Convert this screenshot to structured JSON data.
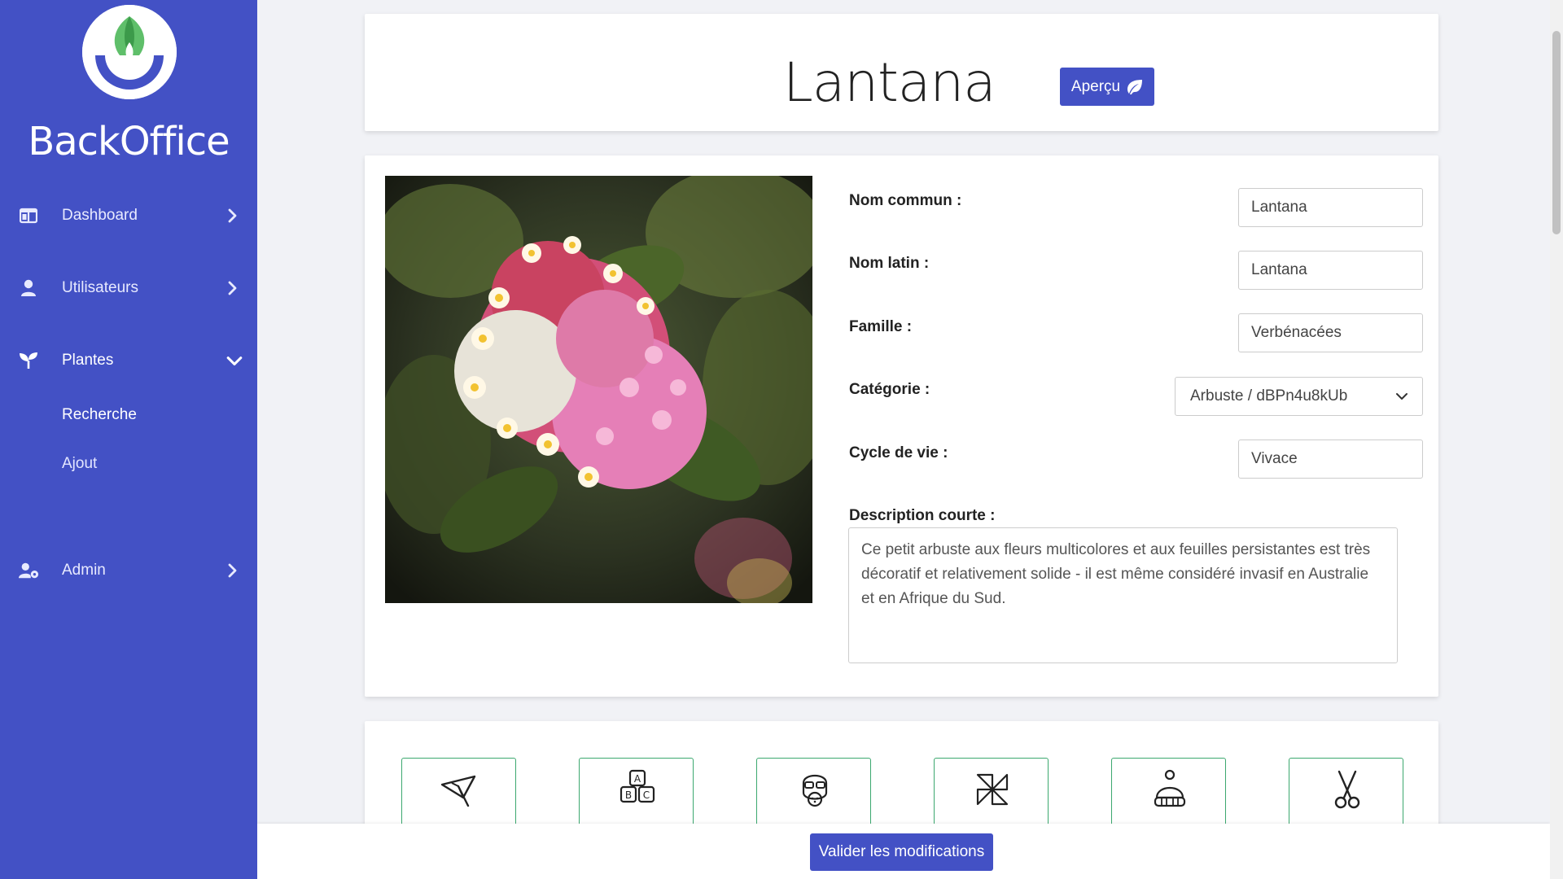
{
  "app": {
    "brand": "BackOffice"
  },
  "sidebar": {
    "items": [
      {
        "label": "Dashboard",
        "icon": "dashboard-icon"
      },
      {
        "label": "Utilisateurs",
        "icon": "user-icon"
      },
      {
        "label": "Plantes",
        "icon": "sprout-icon"
      },
      {
        "label": "Admin",
        "icon": "admin-user-icon"
      }
    ],
    "plantes_sub": [
      {
        "label": "Recherche"
      },
      {
        "label": "Ajout"
      }
    ]
  },
  "header": {
    "title": "Lantana",
    "apercu_label": "Aperçu"
  },
  "form": {
    "nom_commun": {
      "label": "Nom commun :",
      "value": "Lantana"
    },
    "nom_latin": {
      "label": "Nom latin :",
      "value": "Lantana"
    },
    "famille": {
      "label": "Famille :",
      "value": "Verbénacées"
    },
    "categorie": {
      "label": "Catégorie :",
      "value": "Arbuste / dBPn4u8kUb"
    },
    "cycle": {
      "label": "Cycle de vie :",
      "value": "Vivace"
    },
    "description": {
      "label": "Description courte :",
      "value": "Ce petit arbuste aux fleurs multicolores et aux feuilles persistantes est très décoratif et relativement solide - il est même considéré invasif en Australie et en Afrique du Sud."
    }
  },
  "tiles": [
    {
      "icon": "umbrella-icon"
    },
    {
      "icon": "abc-blocks-icon"
    },
    {
      "icon": "gas-mask-icon"
    },
    {
      "icon": "pinwheel-icon"
    },
    {
      "icon": "winter-hat-icon"
    },
    {
      "icon": "scissors-icon"
    }
  ],
  "footer": {
    "save_label": "Valider les modifications"
  },
  "colors": {
    "sidebar": "#4351c5",
    "accent": "#4351c5",
    "tile_border": "#3ca86f"
  }
}
